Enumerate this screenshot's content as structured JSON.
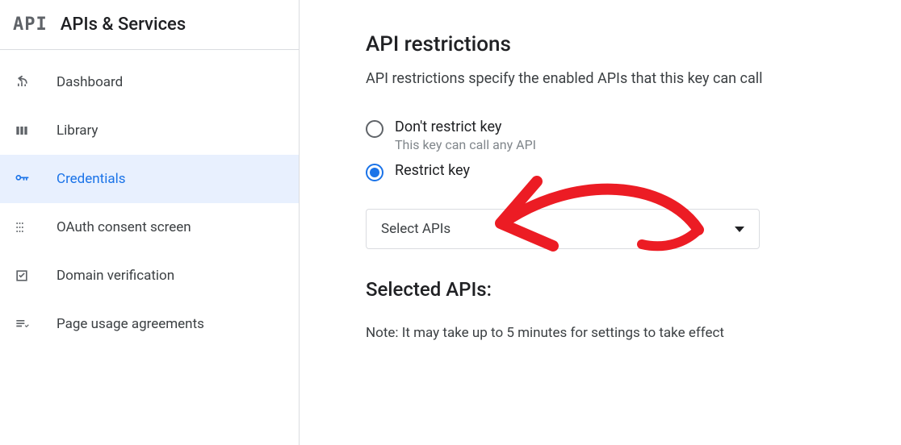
{
  "sidebar": {
    "logo_text": "API",
    "title": "APIs & Services",
    "items": [
      {
        "label": "Dashboard",
        "icon": "dashboard-icon",
        "active": false
      },
      {
        "label": "Library",
        "icon": "library-icon",
        "active": false
      },
      {
        "label": "Credentials",
        "icon": "key-icon",
        "active": true
      },
      {
        "label": "OAuth consent screen",
        "icon": "consent-icon",
        "active": false
      },
      {
        "label": "Domain verification",
        "icon": "check-square-icon",
        "active": false
      },
      {
        "label": "Page usage agreements",
        "icon": "agreement-icon",
        "active": false
      }
    ]
  },
  "main": {
    "restrictions": {
      "title": "API restrictions",
      "description": "API restrictions specify the enabled APIs that this key can call",
      "options": [
        {
          "label": "Don't restrict key",
          "sublabel": "This key can call any API",
          "selected": false
        },
        {
          "label": "Restrict key",
          "sublabel": "",
          "selected": true
        }
      ],
      "dropdown_label": "Select APIs"
    },
    "selected_apis_title": "Selected APIs:",
    "note": "Note: It may take up to 5 minutes for settings to take effect"
  },
  "colors": {
    "accent": "#1a73e8",
    "border": "#dadce0",
    "muted": "#5f6368",
    "annotation": "#ec1c24"
  }
}
